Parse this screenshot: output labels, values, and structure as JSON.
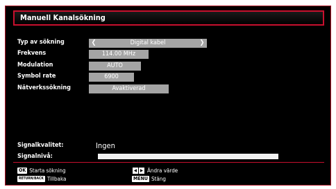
{
  "dialog": {
    "title": "Manuell Kanalsökning"
  },
  "fields": {
    "search_type": {
      "label": "Typ av sökning",
      "value": "Digital kabel"
    },
    "frequency": {
      "label": "Frekvens",
      "value": "114.00 MHz"
    },
    "modulation": {
      "label": "Modulation",
      "value": "AUTO"
    },
    "symbol_rate": {
      "label": "Symbol rate",
      "value": "6900"
    },
    "network_search": {
      "label": "Nätverkssökning",
      "value": "Avaktiverad"
    }
  },
  "signal": {
    "quality_label": "Signalkvalitet:",
    "quality_value": "Ingen",
    "level_label": "Signalnivå:",
    "level_fraction": 0
  },
  "help": {
    "ok_key": "OK",
    "ok_label": "Starta sökning",
    "back_key": "RETURN/BACK",
    "back_label": "Tillbaka",
    "nav_label": "Ändra värde",
    "menu_key": "MENU",
    "menu_label": "Stäng"
  }
}
